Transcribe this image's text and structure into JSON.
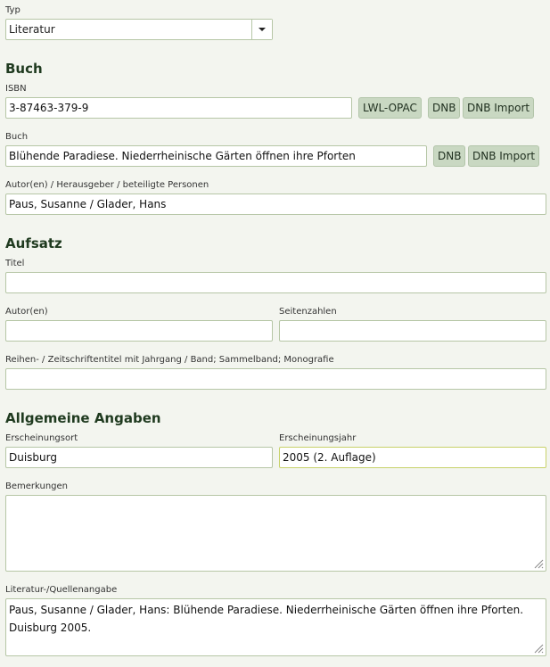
{
  "typ": {
    "label": "Typ",
    "value": "Literatur"
  },
  "buch_section": {
    "heading": "Buch",
    "isbn": {
      "label": "ISBN",
      "value": "3-87463-379-9",
      "buttons": [
        "LWL-OPAC",
        "DNB",
        "DNB Import"
      ]
    },
    "buch": {
      "label": "Buch",
      "value": "Blühende Paradiese. Niederrheinische Gärten öffnen ihre Pforten",
      "buttons": [
        "DNB",
        "DNB Import"
      ]
    },
    "autoren": {
      "label": "Autor(en) / Herausgeber / beteiligte Personen",
      "value": "Paus, Susanne / Glader, Hans"
    }
  },
  "aufsatz_section": {
    "heading": "Aufsatz",
    "titel": {
      "label": "Titel",
      "value": ""
    },
    "autor": {
      "label": "Autor(en)",
      "value": ""
    },
    "seitenzahlen": {
      "label": "Seitenzahlen",
      "value": ""
    },
    "reihe": {
      "label": "Reihen- / Zeitschriftentitel mit Jahrgang / Band; Sammelband; Monografie",
      "value": ""
    }
  },
  "allgemein_section": {
    "heading": "Allgemeine Angaben",
    "ort": {
      "label": "Erscheinungsort",
      "value": "Duisburg"
    },
    "jahr": {
      "label": "Erscheinungsjahr",
      "value": "2005 (2. Auflage)"
    },
    "bemerkungen": {
      "label": "Bemerkungen",
      "value": ""
    },
    "quelle": {
      "label": "Literatur-/Quellenangabe",
      "value": "Paus, Susanne / Glader, Hans: Blühende Paradiese. Niederrheinische Gärten öffnen ihre Pforten. Duisburg 2005."
    }
  },
  "icons": {
    "dropdown": "chevron-down-icon",
    "resize": "resize-grip-icon"
  }
}
